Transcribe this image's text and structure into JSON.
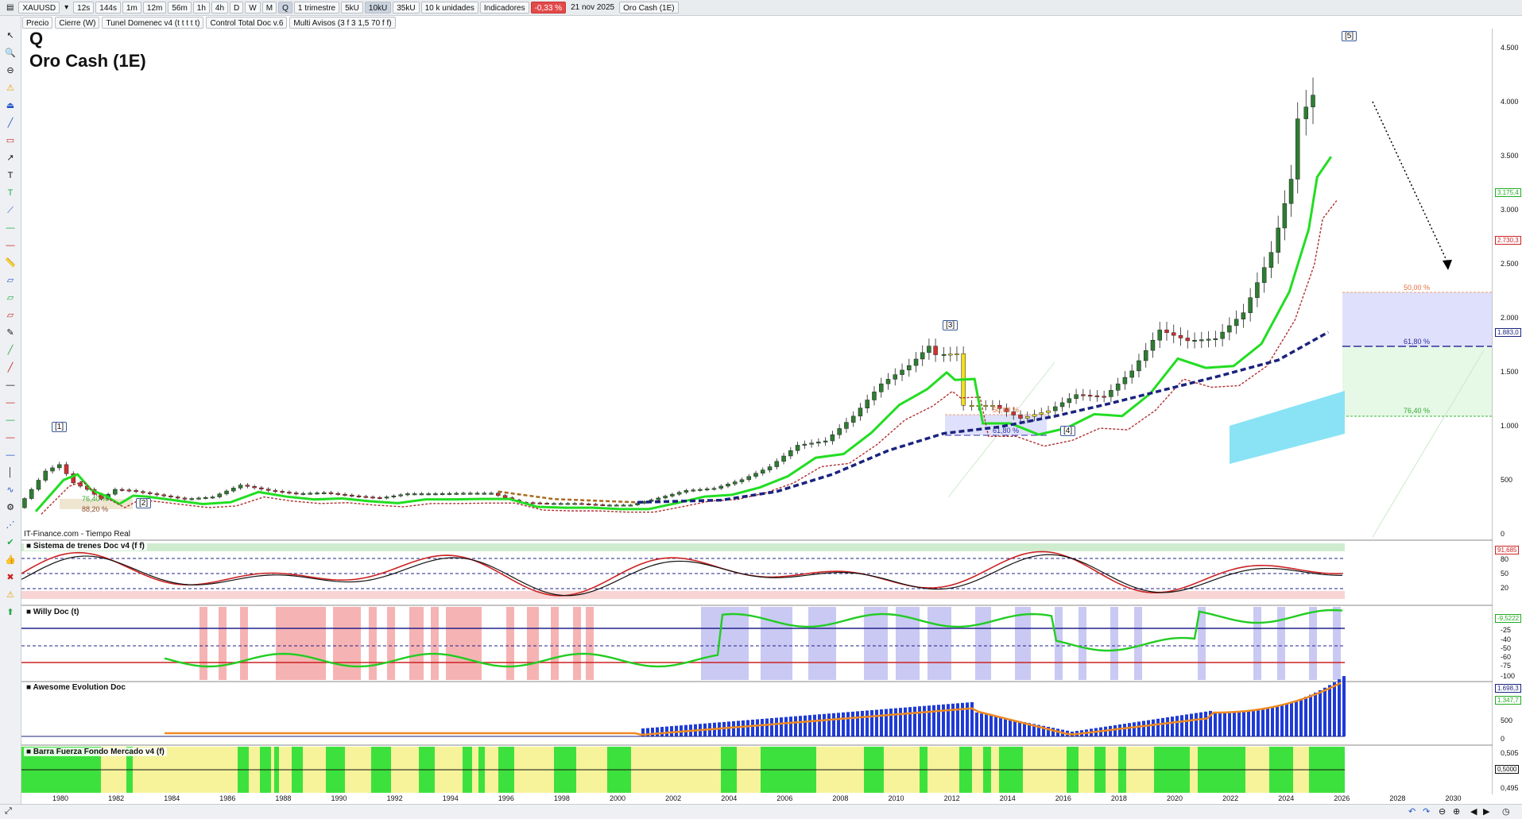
{
  "toolbar": {
    "symbol": "XAUUSD",
    "timeframes": [
      "12s",
      "144s",
      "1m",
      "12m",
      "56m",
      "1h",
      "4h",
      "D",
      "W",
      "M",
      "Q"
    ],
    "period": "1 trimestre",
    "units": [
      "5kU",
      "10kU",
      "35kU"
    ],
    "unit_select": "10 k unidades",
    "indicators": "Indicadores",
    "change": "-0,33 %",
    "date": "21 nov 2025",
    "instrument": "Oro Cash (1E)"
  },
  "legend_row": {
    "items": [
      "Precio",
      "Cierre (W)",
      "Tunel Domenec v4 (t t t t t)",
      "Control Total Doc v.6",
      "Multi Avisos (3 f 3 1,5 70 f f)"
    ]
  },
  "chart": {
    "letter": "Q",
    "name": "Oro Cash (1E)",
    "source": "IT-Finance.com - Tiempo Real",
    "waves": [
      "[1]",
      "[2]",
      "[3]",
      "[4]",
      "[5]"
    ],
    "fib_labels_left": [
      "76,40 %",
      "88,20 %"
    ],
    "fib_labels_mid": [
      "50,00 %",
      "61,80 %"
    ],
    "fib_labels_right": [
      "50,00 %",
      "61,80 %",
      "76,40 %"
    ],
    "price_ticks": [
      "4.500",
      "4.000",
      "3.500",
      "3.000",
      "2.500",
      "2.000",
      "1.500",
      "1.000",
      "500",
      "0"
    ],
    "price_tags": [
      "3.175,4",
      "2.730,3",
      "1.883,0"
    ],
    "year_ticks": [
      "1980",
      "1982",
      "1984",
      "1986",
      "1988",
      "1990",
      "1992",
      "1994",
      "1996",
      "1998",
      "2000",
      "2002",
      "2004",
      "2006",
      "2008",
      "2010",
      "2012",
      "2014",
      "2016",
      "2018",
      "2020",
      "2022",
      "2024",
      "2026",
      "2028",
      "2030"
    ]
  },
  "panels": {
    "trenes": {
      "name": "Sistema de trenes Doc v4 (f f)",
      "ticks": [
        "80",
        "50",
        "20"
      ],
      "tag": "91,685"
    },
    "willy": {
      "name": "Willy Doc (t)",
      "ticks": [
        "-25",
        "-40",
        "-50",
        "-60",
        "-75",
        "-100"
      ],
      "tag": "-9,5222"
    },
    "awesome": {
      "name": "Awesome Evolution Doc",
      "ticks": [
        "500",
        "0"
      ],
      "tags": [
        "1.698,3",
        "1.347,7"
      ]
    },
    "barra": {
      "name": "Barra Fuerza Fondo Mercado v4 (f)",
      "ticks": [
        "0,505",
        "0,495"
      ],
      "tag": "0,5000"
    }
  },
  "colors": {
    "up": "#2e7d32",
    "down": "#d32f2f",
    "tunnel": "#22cc22",
    "support": "#1a237e"
  }
}
